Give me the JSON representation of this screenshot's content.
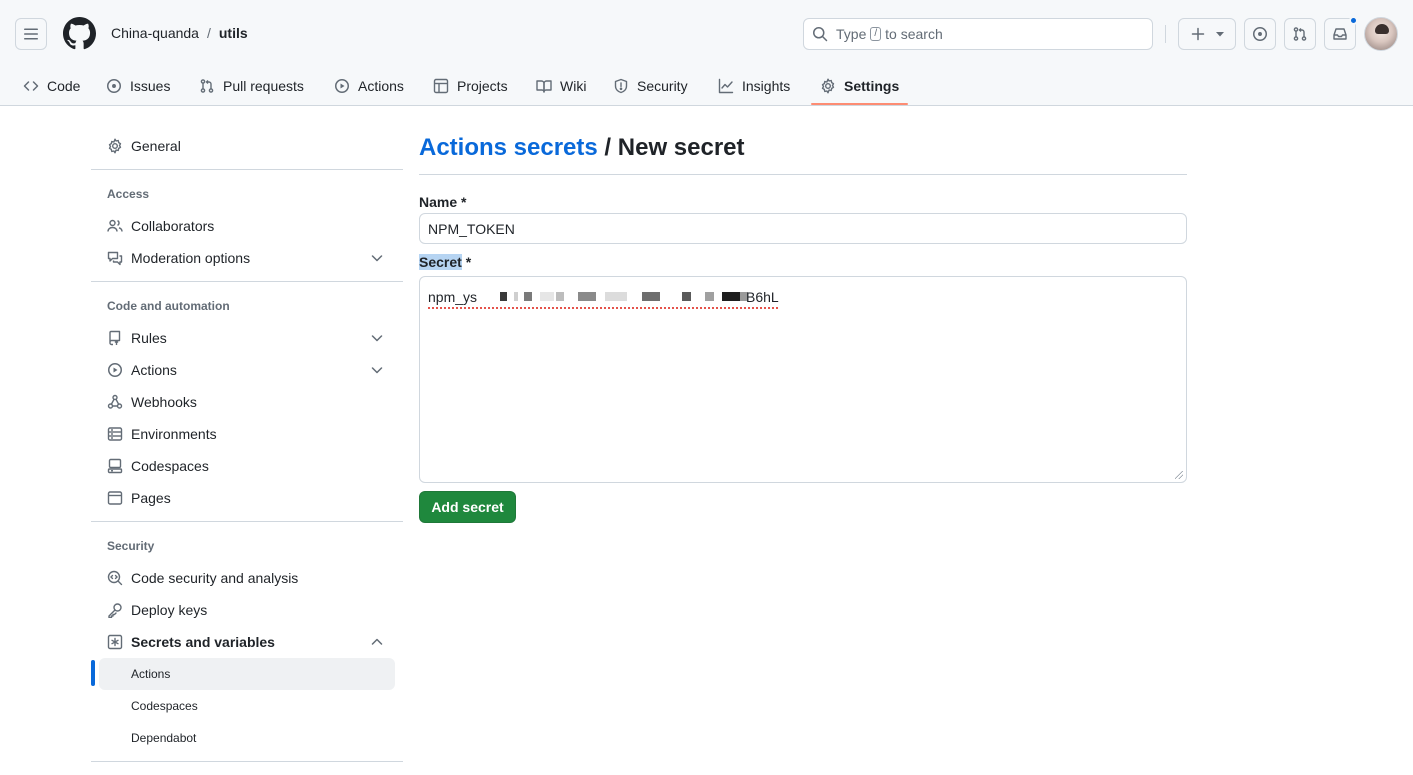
{
  "header": {
    "owner": "China-quanda",
    "separator": "/",
    "repo": "utils",
    "search": {
      "prefix": "Type",
      "key": "/",
      "suffix": "to search"
    }
  },
  "tabs": [
    {
      "label": "Code",
      "icon": "code-icon"
    },
    {
      "label": "Issues",
      "icon": "issue-opened-icon"
    },
    {
      "label": "Pull requests",
      "icon": "git-pull-request-icon"
    },
    {
      "label": "Actions",
      "icon": "play-icon"
    },
    {
      "label": "Projects",
      "icon": "table-icon"
    },
    {
      "label": "Wiki",
      "icon": "book-icon"
    },
    {
      "label": "Security",
      "icon": "shield-icon"
    },
    {
      "label": "Insights",
      "icon": "graph-icon"
    },
    {
      "label": "Settings",
      "icon": "gear-icon",
      "selected": true
    }
  ],
  "sidebar": {
    "general": "General",
    "access_heading": "Access",
    "access": [
      "Collaborators",
      "Moderation options"
    ],
    "code_heading": "Code and automation",
    "code": [
      "Rules",
      "Actions",
      "Webhooks",
      "Environments",
      "Codespaces",
      "Pages"
    ],
    "security_heading": "Security",
    "security": [
      "Code security and analysis",
      "Deploy keys",
      "Secrets and variables"
    ],
    "secrets_sub": [
      "Actions",
      "Codespaces",
      "Dependabot"
    ]
  },
  "main": {
    "title_link": "Actions secrets",
    "title_rest": "/ New secret",
    "name_label": "Name",
    "name_value": "NPM_TOKEN",
    "secret_label": "Secret",
    "required_mark": "*",
    "secret_prefix": "npm_ys",
    "secret_suffix": "B6hL",
    "add_button": "Add secret"
  },
  "colors": {
    "accent": "#0969da",
    "primary_button": "#1f883d",
    "tab_underline": "#fd8c73"
  }
}
